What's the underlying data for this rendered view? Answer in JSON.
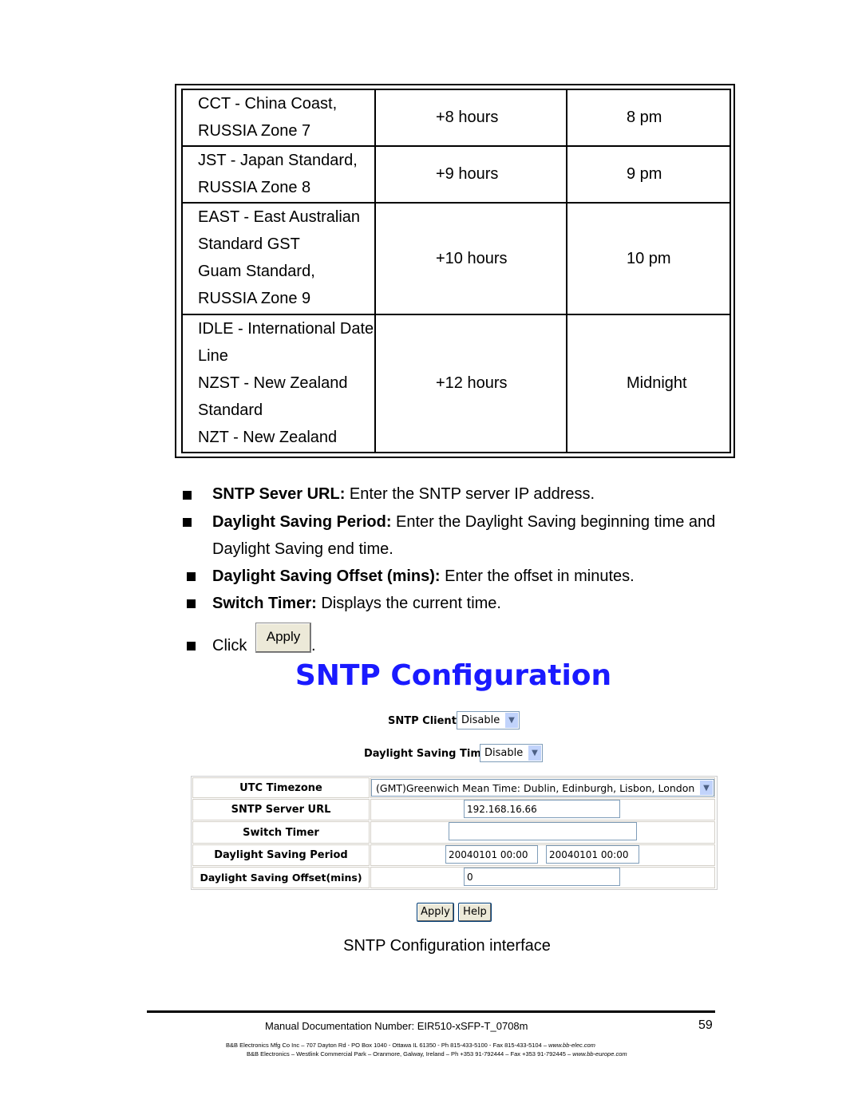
{
  "timezone_table": {
    "rows": [
      {
        "zone": [
          "CCT - China Coast,",
          "RUSSIA Zone 7"
        ],
        "offset": "+8 hours",
        "time": "8 pm"
      },
      {
        "zone": [
          "JST - Japan Standard,",
          "RUSSIA Zone 8"
        ],
        "offset": "+9 hours",
        "time": "9 pm"
      },
      {
        "zone": [
          "EAST - East Australian",
          "Standard GST",
          "Guam Standard,",
          "RUSSIA Zone 9"
        ],
        "offset": "+10 hours",
        "time": "10 pm"
      },
      {
        "zone": [
          "IDLE - International Date",
          "Line",
          "NZST - New Zealand",
          "Standard",
          "NZT - New Zealand"
        ],
        "offset": "+12 hours",
        "time": "Midnight"
      }
    ]
  },
  "bullets": [
    {
      "term": "SNTP Sever URL:",
      "text": " Enter the SNTP server IP address."
    },
    {
      "term": "Daylight Saving Period:",
      "text": " Enter the Daylight Saving beginning time and",
      "text2": "Daylight Saving end time."
    },
    {
      "term": "Daylight Saving Offset (mins):",
      "text": " Enter the offset in minutes."
    },
    {
      "term": "Switch Timer:",
      "text": " Displays the current time."
    },
    {
      "text": "Click",
      "button": "Apply",
      "after": "."
    }
  ],
  "form": {
    "title": "SNTP Configuration",
    "title_color": "#1a1aff",
    "sntp_client_label": "SNTP Client :",
    "sntp_client_value": "Disable",
    "dst_label": "Daylight Saving Time :",
    "dst_value": "Disable",
    "rows": {
      "utc_label": "UTC Timezone",
      "utc_value": "(GMT)Greenwich Mean Time: Dublin, Edinburgh, Lisbon, London",
      "server_label": "SNTP Server URL",
      "server_value": "192.168.16.66",
      "timer_label": "Switch Timer",
      "timer_value": "",
      "period_label": "Daylight Saving Period",
      "period_start": "20040101 00:00",
      "period_end": "20040101 00:00",
      "offset_label": "Daylight Saving Offset(mins)",
      "offset_value": "0"
    },
    "apply": "Apply",
    "help": "Help"
  },
  "caption": "SNTP Configuration interface",
  "footer": {
    "doc_number": "Manual Documentation Number: EIR510-xSFP-T_0708m",
    "page": "59",
    "line1": "B&B Electronics Mfg Co Inc – 707 Dayton Rd - PO Box 1040 - Ottawa IL 61350 - Ph 815-433-5100 - Fax 815-433-5104 – ",
    "line1_url": "www.bb-elec.com",
    "line2": "B&B Electronics – Westlink Commercial Park – Oranmore, Galway, Ireland – Ph +353 91-792444 – Fax +353 91-792445 – ",
    "line2_url": "www.bb-europe.com"
  }
}
